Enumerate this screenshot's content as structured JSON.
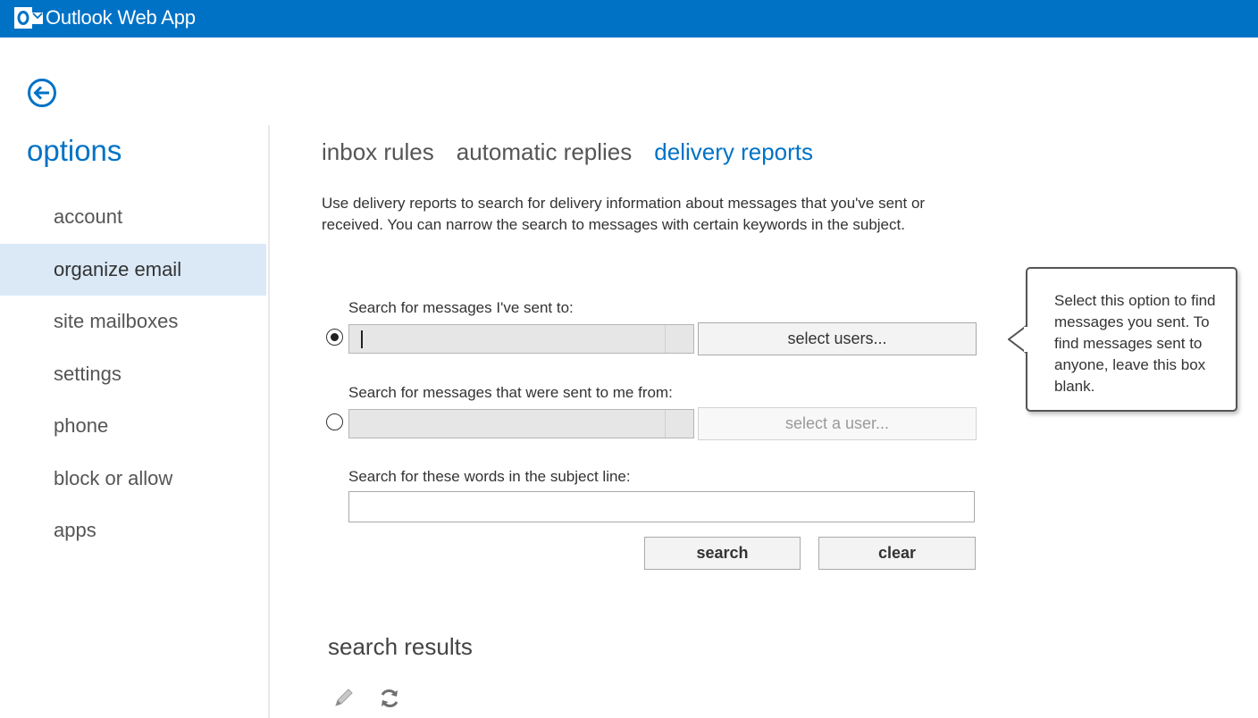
{
  "app": {
    "title": "Outlook Web App",
    "logo_icon": "outlook-logo-icon",
    "brand_color": "#0072c6"
  },
  "back": {
    "icon": "back-arrow-icon"
  },
  "sidebar": {
    "title": "options",
    "items": [
      {
        "label": "account",
        "selected": false
      },
      {
        "label": "organize email",
        "selected": true
      },
      {
        "label": "site mailboxes",
        "selected": false
      },
      {
        "label": "settings",
        "selected": false
      },
      {
        "label": "phone",
        "selected": false
      },
      {
        "label": "block or allow",
        "selected": false
      },
      {
        "label": "apps",
        "selected": false
      }
    ]
  },
  "tabs": [
    {
      "label": "inbox rules",
      "active": false
    },
    {
      "label": "automatic replies",
      "active": false
    },
    {
      "label": "delivery reports",
      "active": true
    }
  ],
  "intro_text": "Use delivery reports to search for delivery information about messages that you've sent or received. You can narrow the search to messages with certain keywords in the subject.",
  "form": {
    "sent_to": {
      "label": "Search for messages I've sent to:",
      "selected": true,
      "value": "",
      "button_label": "select users..."
    },
    "sent_from": {
      "label": "Search for messages that were sent to me from:",
      "selected": false,
      "value": "",
      "button_label": "select a user..."
    },
    "subject": {
      "label": "Search for these words in the subject line:",
      "value": ""
    },
    "search_label": "search",
    "clear_label": "clear"
  },
  "callout_text": "Select this option to find messages you sent. To find messages sent to anyone, leave this box blank.",
  "results": {
    "title": "search results",
    "tools": [
      {
        "icon": "pencil-icon"
      },
      {
        "icon": "refresh-icon"
      }
    ]
  }
}
